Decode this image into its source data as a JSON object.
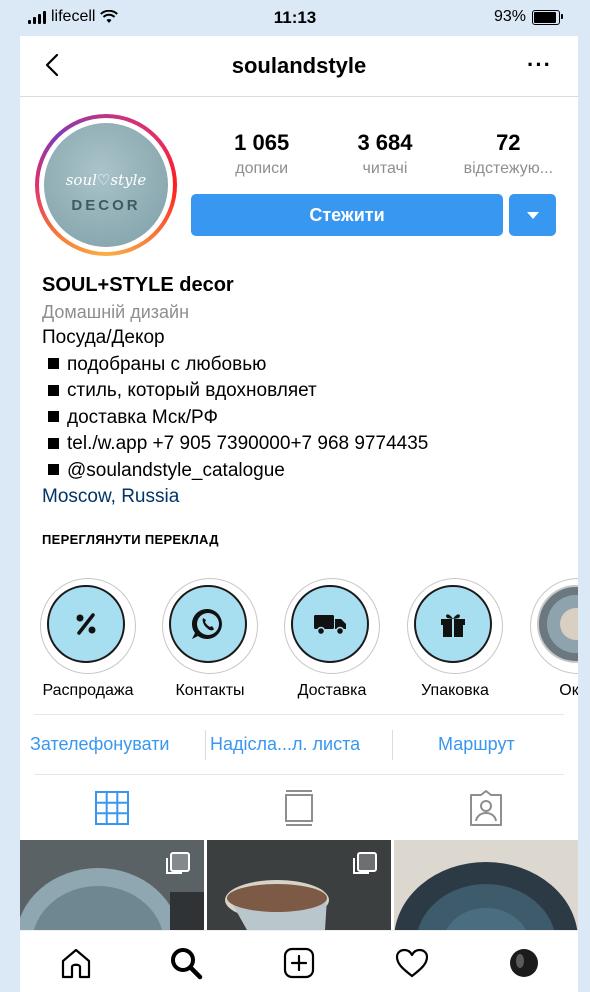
{
  "status_bar": {
    "carrier": "lifecell",
    "time": "11:13",
    "battery_text": "93%",
    "battery_level": 0.93
  },
  "header": {
    "username": "soulandstyle",
    "more": "···"
  },
  "avatar": {
    "script": "soul♡style",
    "word": "DECOR"
  },
  "stats": [
    {
      "value": "1 065",
      "label": "дописи"
    },
    {
      "value": "3 684",
      "label": "читачі"
    },
    {
      "value": "72",
      "label": "відстежую..."
    }
  ],
  "follow_button": "Стежити",
  "bio": {
    "name": "SOUL+STYLE decor",
    "category": "Домашній дизайн",
    "line1": "Посуда/Декор",
    "bullets": [
      "подобраны с любовью",
      "стиль, который вдохновляет",
      "доставка Мск/РФ",
      "tel./w.app +7 905 7390000+7 968 9774435",
      "@soulandstyle_catalogue"
    ],
    "location": "Moscow, Russia"
  },
  "translate_link": "ПЕРЕГЛЯНУТИ ПЕРЕКЛАД",
  "highlights": [
    {
      "label": "Распродажа",
      "icon": "percent-icon"
    },
    {
      "label": "Контакты",
      "icon": "whatsapp-icon"
    },
    {
      "label": "Доставка",
      "icon": "truck-icon"
    },
    {
      "label": "Упаковка",
      "icon": "gift-icon"
    },
    {
      "label": "Океа",
      "icon": "photo-thumbnail"
    }
  ],
  "contacts": {
    "call": "Зателефонувати",
    "email": "Надісла...л. листа",
    "directions": "Маршрут"
  },
  "colors": {
    "accent": "#3897f0",
    "link": "#003569",
    "highlight_fill": "#a7def0"
  }
}
